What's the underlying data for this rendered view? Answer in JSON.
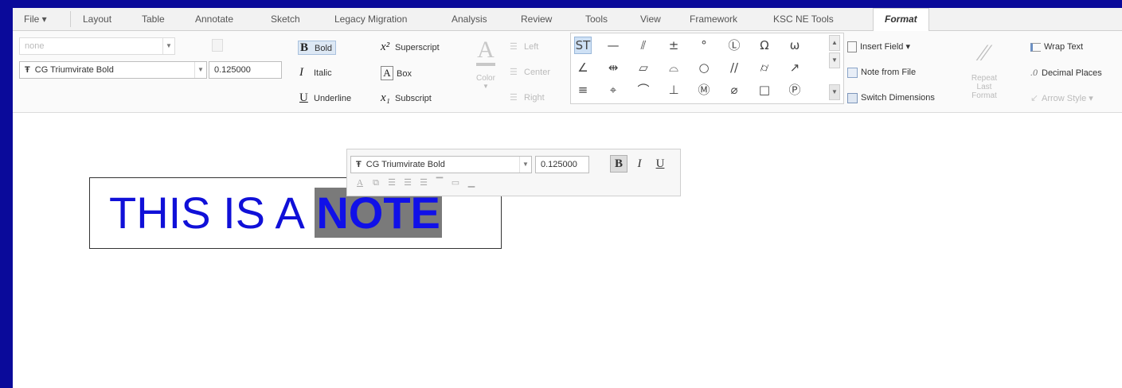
{
  "tabs": [
    {
      "label": "File ▾"
    },
    {
      "label": "Layout"
    },
    {
      "label": "Table"
    },
    {
      "label": "Annotate"
    },
    {
      "label": "Sketch"
    },
    {
      "label": "Legacy Migration"
    },
    {
      "label": "Analysis"
    },
    {
      "label": "Review"
    },
    {
      "label": "Tools"
    },
    {
      "label": "View"
    },
    {
      "label": "Framework"
    },
    {
      "label": "KSC NE Tools"
    },
    {
      "label": "Format"
    }
  ],
  "ribbon": {
    "style_combo": "none",
    "font_combo": "CG Triumvirate Bold",
    "font_glyph": "Ŧ",
    "height_value": "0.125000",
    "bold": "Bold",
    "italic": "Italic",
    "underline": "Underline",
    "superscript": "Superscript",
    "box": "Box",
    "subscript": "Subscript",
    "color": "Color",
    "align_left": "Left",
    "align_center": "Center",
    "align_right": "Right",
    "insert_field": "Insert Field ▾",
    "note_from_file": "Note from File",
    "switch_dimensions": "Switch Dimensions",
    "repeat_last_format": "Repeat Last Format",
    "wrap_text": "Wrap Text",
    "decimal_places": "Decimal Places",
    "arrow_style": "Arrow Style ▾",
    "symbols": [
      "ST",
      "—",
      "⫽",
      "±",
      "°",
      "Ⓛ",
      "Ω",
      "ω",
      "∠",
      "⇹",
      "▱",
      "⌓",
      "○",
      "//",
      "⌭",
      "↗",
      "≡",
      "⌖",
      "⌒",
      "⊥",
      "Ⓜ",
      "⌀",
      "□",
      "Ⓟ"
    ]
  },
  "canvas": {
    "note_plain": "THIS IS A ",
    "note_selected": "NOTE"
  },
  "mini_toolbar": {
    "font": "CG Triumvirate Bold",
    "height": "0.125000",
    "bold": "B",
    "italic": "I",
    "underline": "U"
  },
  "colors": {
    "note_text": "#1010d8",
    "selection_bg": "#7a7a7a",
    "slide_border": "#0a0a9a"
  }
}
